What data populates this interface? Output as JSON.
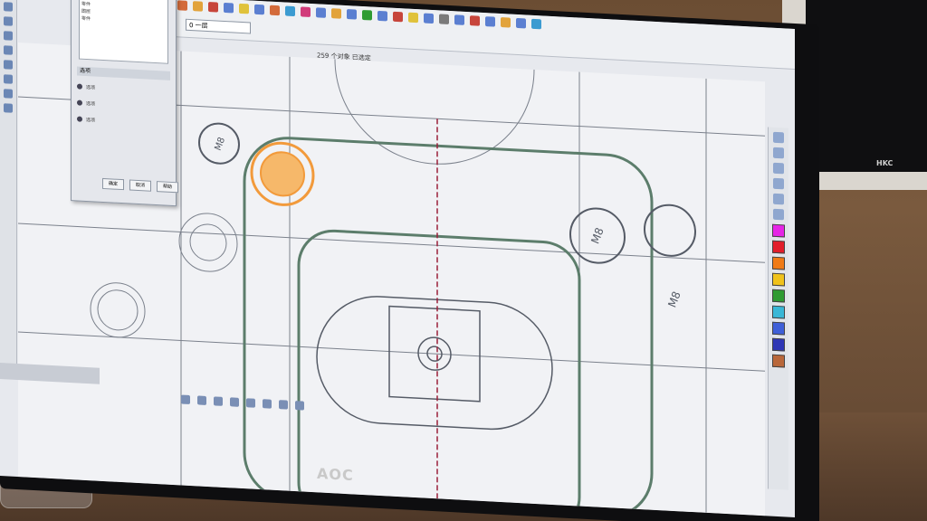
{
  "screen": {
    "status_text": "259 个对象 已选定",
    "layer_dropdown": "0 一层"
  },
  "dialog": {
    "list_items": [
      "图层",
      "零件",
      "图层",
      "零件"
    ],
    "section_label": "选项",
    "options": [
      "选项",
      "选项",
      "选项"
    ],
    "buttons": [
      "确定",
      "取消",
      "帮助"
    ]
  },
  "cad_labels": {
    "label_left": "M8",
    "label_right_a": "M8",
    "label_right_b": "M8"
  },
  "brand": {
    "monitor_logo": "AOC",
    "second_monitor_logo": "HKC"
  },
  "palette": [
    "#e624e6",
    "#e21d2a",
    "#f07b16",
    "#f0c21a",
    "#2f9b32",
    "#39b7d6",
    "#3e5fd8",
    "#2e36b5",
    "#b9673a"
  ],
  "accent_color": "#f29a3b"
}
